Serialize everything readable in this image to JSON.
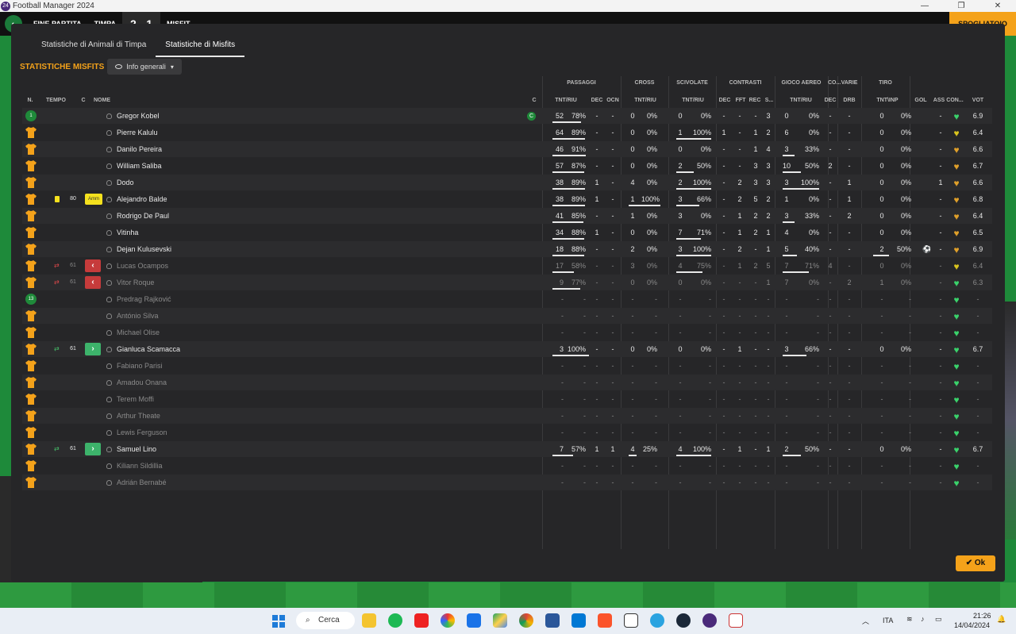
{
  "window": {
    "title": "Football Manager 2024",
    "logo": "24",
    "controls": [
      "—",
      "❐",
      "✕"
    ]
  },
  "gamebar": {
    "status": "FINE PARTITA",
    "home": "TIMPA",
    "score": "2 - 1",
    "away": "MISFIT",
    "right_label": "SPOGLIATOIO"
  },
  "tabs": [
    "Statistiche di Animali di Timpa",
    "Statistiche di Misfits"
  ],
  "header": {
    "title": "STATISTICHE MISFITS",
    "dropdown": "Info generali"
  },
  "groups": [
    "PASSAGGI",
    "CROSS",
    "SCIVOLATE",
    "CONTRASTI",
    "GIOCO AEREO",
    "CO...",
    "VARIE",
    "TIRO"
  ],
  "columns": {
    "n": "N.",
    "tempo": "TEMPO",
    "c": "C",
    "nome": "NOME",
    "capt": "C",
    "pas_tr": "TNT/RIU",
    "pas_dec": "DEC",
    "pas_ocn": "OCN",
    "cross_tr": "TNT/RIU",
    "sciv_tr": "TNT/RIU",
    "con_dec": "DEC",
    "con_fft": "FFT",
    "con_rec": "REC",
    "con_s": "S...",
    "aer_tr": "TNT/RIU",
    "co_dec": "DEC",
    "drb": "DRB",
    "tiro_ti": "TNT\\INP",
    "gol": "GOL",
    "ass": "ASS",
    "con": "CON...",
    "vot": "VOT"
  },
  "players": [
    {
      "num": "1",
      "gk": true,
      "name": "Gregor Kobel",
      "capt": "C",
      "pt": "52",
      "pp": "78%",
      "pdec": "-",
      "pocn": "-",
      "ct": "0",
      "cp": "0%",
      "st": "0",
      "sp": "0%",
      "cdec": "-",
      "cfft": "-",
      "crec": "-",
      "cs": "3",
      "at": "0",
      "ap": "0%",
      "codec": "-",
      "drb": "-",
      "tt": "0",
      "tp": "0%",
      "gol": "",
      "ass": "-",
      "heart": "green",
      "vot": "6.9",
      "pb": 0.78,
      "cb": 0,
      "sb": 0,
      "ab": 0,
      "tb": 0
    },
    {
      "name": "Pierre Kalulu",
      "pt": "64",
      "pp": "89%",
      "pdec": "-",
      "pocn": "-",
      "ct": "0",
      "cp": "0%",
      "st": "1",
      "sp": "100%",
      "cdec": "1",
      "cfft": "-",
      "crec": "1",
      "cs": "2",
      "at": "6",
      "ap": "0%",
      "codec": "-",
      "drb": "-",
      "tt": "0",
      "tp": "0%",
      "gol": "",
      "ass": "-",
      "heart": "yellow",
      "vot": "6.4",
      "pb": 0.89,
      "cb": 0,
      "sb": 1,
      "ab": 0,
      "tb": 0
    },
    {
      "name": "Danilo Pereira",
      "pt": "46",
      "pp": "91%",
      "pdec": "-",
      "pocn": "-",
      "ct": "0",
      "cp": "0%",
      "st": "0",
      "sp": "0%",
      "cdec": "-",
      "cfft": "-",
      "crec": "1",
      "cs": "4",
      "at": "3",
      "ap": "33%",
      "codec": "-",
      "drb": "-",
      "tt": "0",
      "tp": "0%",
      "gol": "",
      "ass": "-",
      "heart": "orange",
      "vot": "6.6",
      "pb": 0.91,
      "cb": 0,
      "sb": 0,
      "ab": 0.33,
      "tb": 0
    },
    {
      "name": "William Saliba",
      "pt": "57",
      "pp": "87%",
      "pdec": "-",
      "pocn": "-",
      "ct": "0",
      "cp": "0%",
      "st": "2",
      "sp": "50%",
      "cdec": "-",
      "cfft": "-",
      "crec": "3",
      "cs": "3",
      "at": "10",
      "ap": "50%",
      "codec": "2",
      "drb": "-",
      "tt": "0",
      "tp": "0%",
      "gol": "",
      "ass": "-",
      "heart": "orange",
      "vot": "6.7",
      "pb": 0.87,
      "cb": 0,
      "sb": 0.5,
      "ab": 0.5,
      "tb": 0
    },
    {
      "name": "Dodo",
      "pt": "38",
      "pp": "89%",
      "pdec": "1",
      "pocn": "-",
      "ct": "4",
      "cp": "0%",
      "st": "2",
      "sp": "100%",
      "cdec": "-",
      "cfft": "2",
      "crec": "3",
      "cs": "3",
      "at": "3",
      "ap": "100%",
      "codec": "-",
      "drb": "1",
      "tt": "0",
      "tp": "0%",
      "gol": "",
      "ass": "1",
      "heart": "orange",
      "vot": "6.6",
      "pb": 0.89,
      "cb": 0,
      "sb": 1,
      "ab": 1,
      "tb": 0
    },
    {
      "name": "Alejandro Balde",
      "yc": true,
      "tempo": "80",
      "amm": "Amm",
      "pt": "38",
      "pp": "89%",
      "pdec": "1",
      "pocn": "-",
      "ct": "1",
      "cp": "100%",
      "st": "3",
      "sp": "66%",
      "cdec": "-",
      "cfft": "2",
      "crec": "5",
      "cs": "2",
      "at": "1",
      "ap": "0%",
      "codec": "-",
      "drb": "1",
      "tt": "0",
      "tp": "0%",
      "gol": "",
      "ass": "-",
      "heart": "orange",
      "vot": "6.8",
      "pb": 0.89,
      "cb": 1,
      "sb": 0.66,
      "ab": 0,
      "tb": 0
    },
    {
      "name": "Rodrigo De Paul",
      "pt": "41",
      "pp": "85%",
      "pdec": "-",
      "pocn": "-",
      "ct": "1",
      "cp": "0%",
      "st": "3",
      "sp": "0%",
      "cdec": "-",
      "cfft": "1",
      "crec": "2",
      "cs": "2",
      "at": "3",
      "ap": "33%",
      "codec": "-",
      "drb": "2",
      "tt": "0",
      "tp": "0%",
      "gol": "",
      "ass": "-",
      "heart": "orange",
      "vot": "6.4",
      "pb": 0.85,
      "cb": 0,
      "sb": 0,
      "ab": 0.33,
      "tb": 0
    },
    {
      "name": "Vitinha",
      "pt": "34",
      "pp": "88%",
      "pdec": "1",
      "pocn": "-",
      "ct": "0",
      "cp": "0%",
      "st": "7",
      "sp": "71%",
      "cdec": "-",
      "cfft": "1",
      "crec": "2",
      "cs": "1",
      "at": "4",
      "ap": "0%",
      "codec": "-",
      "drb": "-",
      "tt": "0",
      "tp": "0%",
      "gol": "",
      "ass": "-",
      "heart": "orange",
      "vot": "6.5",
      "pb": 0.88,
      "cb": 0,
      "sb": 0.71,
      "ab": 0,
      "tb": 0
    },
    {
      "name": "Dejan Kulusevski",
      "pt": "18",
      "pp": "88%",
      "pdec": "-",
      "pocn": "-",
      "ct": "2",
      "cp": "0%",
      "st": "3",
      "sp": "100%",
      "cdec": "-",
      "cfft": "2",
      "crec": "-",
      "cs": "1",
      "at": "5",
      "ap": "40%",
      "codec": "-",
      "drb": "-",
      "tt": "2",
      "tp": "50%",
      "gol": "⚽",
      "ass": "-",
      "heart": "orange",
      "vot": "6.9",
      "pb": 0.88,
      "cb": 0,
      "sb": 1,
      "ab": 0.4,
      "tb": 0.5
    },
    {
      "name": "Lucas Ocampos",
      "out": true,
      "tempo": "61",
      "pt": "17",
      "pp": "58%",
      "pdec": "-",
      "pocn": "-",
      "ct": "3",
      "cp": "0%",
      "st": "4",
      "sp": "75%",
      "cdec": "-",
      "cfft": "1",
      "crec": "2",
      "cs": "5",
      "at": "7",
      "ap": "71%",
      "codec": "4",
      "drb": "-",
      "tt": "0",
      "tp": "0%",
      "gol": "",
      "ass": "-",
      "heart": "yellow",
      "vot": "6.4",
      "pb": 0.58,
      "cb": 0,
      "sb": 0.75,
      "ab": 0.71,
      "tb": 0,
      "dim": true
    },
    {
      "name": "Vitor Roque",
      "out": true,
      "tempo": "61",
      "pt": "9",
      "pp": "77%",
      "pdec": "-",
      "pocn": "-",
      "ct": "0",
      "cp": "0%",
      "st": "0",
      "sp": "0%",
      "cdec": "-",
      "cfft": "-",
      "crec": "-",
      "cs": "1",
      "at": "7",
      "ap": "0%",
      "codec": "-",
      "drb": "2",
      "tt": "1",
      "tp": "0%",
      "gol": "",
      "ass": "-",
      "heart": "green",
      "vot": "6.3",
      "pb": 0.77,
      "cb": 0,
      "sb": 0,
      "ab": 0,
      "tb": 0,
      "dim": true
    },
    {
      "num": "13",
      "gk": true,
      "name": "Predrag Rajković",
      "empty": true,
      "dim": true
    },
    {
      "name": "António Silva",
      "empty": true,
      "dim": true
    },
    {
      "name": "Michael Olise",
      "empty": true,
      "dim": true
    },
    {
      "name": "Gianluca Scamacca",
      "in": true,
      "tempo": "61",
      "pt": "3",
      "pp": "100%",
      "pdec": "-",
      "pocn": "-",
      "ct": "0",
      "cp": "0%",
      "st": "0",
      "sp": "0%",
      "cdec": "-",
      "cfft": "1",
      "crec": "-",
      "cs": "-",
      "at": "3",
      "ap": "66%",
      "codec": "-",
      "drb": "-",
      "tt": "0",
      "tp": "0%",
      "gol": "",
      "ass": "-",
      "heart": "green",
      "vot": "6.7",
      "pb": 1,
      "cb": 0,
      "sb": 0,
      "ab": 0.66,
      "tb": 0
    },
    {
      "name": "Fabiano Parisi",
      "empty": true,
      "dim": true
    },
    {
      "name": "Amadou Onana",
      "empty": true,
      "dim": true
    },
    {
      "name": "Terem Moffi",
      "empty": true,
      "dim": true
    },
    {
      "name": "Arthur Theate",
      "empty": true,
      "dim": true
    },
    {
      "name": "Lewis Ferguson",
      "empty": true,
      "dim": true
    },
    {
      "name": "Samuel Lino",
      "in": true,
      "tempo": "61",
      "pt": "7",
      "pp": "57%",
      "pdec": "1",
      "pocn": "1",
      "ct": "4",
      "cp": "25%",
      "st": "4",
      "sp": "100%",
      "cdec": "-",
      "cfft": "1",
      "crec": "-",
      "cs": "1",
      "at": "2",
      "ap": "50%",
      "codec": "-",
      "drb": "-",
      "tt": "0",
      "tp": "0%",
      "gol": "",
      "ass": "-",
      "heart": "green",
      "vot": "6.7",
      "pb": 0.57,
      "cb": 0.25,
      "sb": 1,
      "ab": 0.5,
      "tb": 0
    },
    {
      "name": "Kiliann Sildillia",
      "empty": true,
      "dim": true
    },
    {
      "name": "Adrián Bernabé",
      "empty": true,
      "dim": true
    }
  ],
  "ok_label": "Ok",
  "colors": {
    "accent": "#f4a21a",
    "shirt": "#f4a21a",
    "green": "#3ad36b",
    "yellow": "#d9c41e",
    "orange": "#e0a02a"
  },
  "taskbar": {
    "search": "Cerca",
    "lang": "ITA",
    "time": "21:26",
    "date": "14/04/2024"
  }
}
